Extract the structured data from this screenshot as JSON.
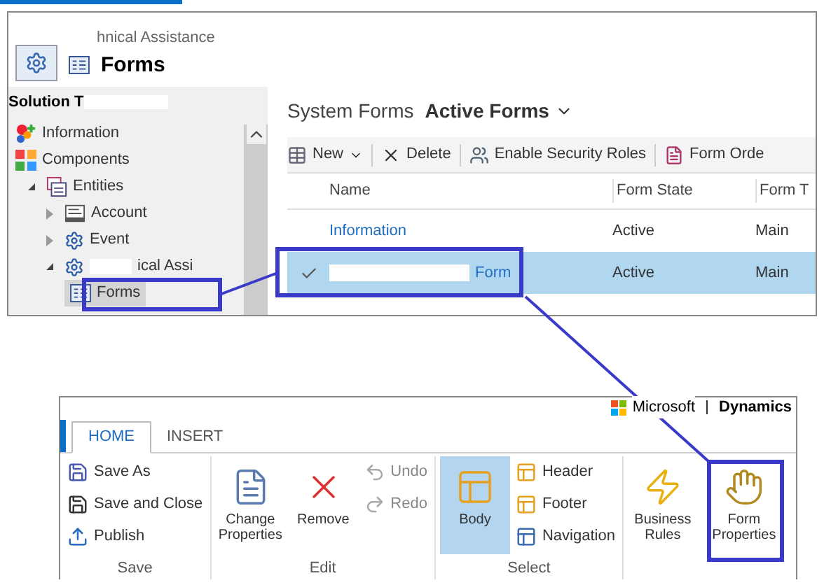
{
  "top_window": {
    "title_fragment": "hnical Assistance",
    "heading": "Forms",
    "solution_label": "Solution T",
    "tree": [
      {
        "label": "Information",
        "selected": false
      },
      {
        "label": "Components",
        "selected": false,
        "children": [
          {
            "label": "Entities",
            "selected": false,
            "expanded": true,
            "children": [
              {
                "label": "Account",
                "selected": false,
                "expanded": false
              },
              {
                "label": "Event",
                "selected": false,
                "expanded": false
              },
              {
                "label": "ical Assi",
                "selected": false,
                "expanded": true,
                "redacted": true,
                "children": [
                  {
                    "label": "Forms",
                    "selected": true
                  }
                ]
              }
            ]
          }
        ]
      }
    ],
    "view_title": "System Forms",
    "view_name": "Active Forms",
    "toolbar": [
      {
        "label": "New",
        "menu": true
      },
      {
        "label": "Delete",
        "menu": false
      },
      {
        "label": "Enable Security Roles",
        "menu": false
      },
      {
        "label": "Form Orde",
        "menu": false
      }
    ],
    "columns": [
      "Name",
      "Form State",
      "Form T"
    ],
    "rows": [
      {
        "name": "Information",
        "state": "Active",
        "type": "Main",
        "selected": false,
        "redacted": false
      },
      {
        "name": "Form",
        "state": "Active",
        "type": "Main",
        "selected": true,
        "redacted": true
      }
    ]
  },
  "ribbon": {
    "brand": [
      "Microsoft",
      "Dynamics"
    ],
    "tabs": [
      {
        "label": "HOME",
        "selected": true
      },
      {
        "label": "INSERT",
        "selected": false
      }
    ],
    "groups": [
      {
        "label": "Save",
        "items": [
          {
            "kind": "small",
            "label": "Save As",
            "disabled": false
          },
          {
            "kind": "small",
            "label": "Save and Close",
            "disabled": false
          },
          {
            "kind": "small",
            "label": "Publish",
            "disabled": false
          }
        ]
      },
      {
        "label": "Edit",
        "items": [
          {
            "kind": "large",
            "label": "Change Properties",
            "disabled": false,
            "selected": false
          },
          {
            "kind": "large",
            "label": "Remove",
            "disabled": false,
            "selected": false
          },
          {
            "kind": "stack",
            "items": [
              {
                "kind": "small",
                "label": "Undo",
                "disabled": true
              },
              {
                "kind": "small",
                "label": "Redo",
                "disabled": true
              }
            ]
          }
        ]
      },
      {
        "label": "Select",
        "items": [
          {
            "kind": "large",
            "label": "Body",
            "disabled": false,
            "selected": true
          },
          {
            "kind": "stack",
            "items": [
              {
                "kind": "small",
                "label": "Header",
                "disabled": false
              },
              {
                "kind": "small",
                "label": "Footer",
                "disabled": false
              },
              {
                "kind": "small",
                "label": "Navigation",
                "disabled": false
              }
            ]
          }
        ]
      },
      {
        "items": [
          {
            "kind": "large",
            "label": "Business Rules",
            "disabled": false,
            "selected": false
          },
          {
            "kind": "large",
            "label": "Form Properties",
            "disabled": false,
            "selected": false
          }
        ]
      }
    ]
  }
}
